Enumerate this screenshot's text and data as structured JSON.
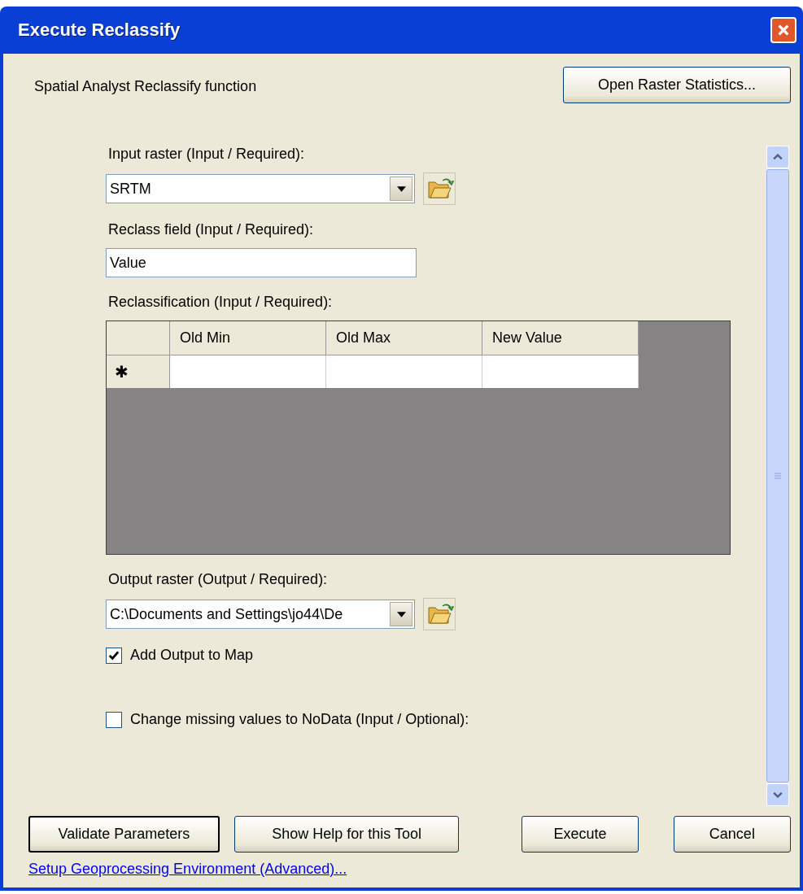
{
  "window": {
    "title": "Execute Reclassify"
  },
  "description": "Spatial Analyst Reclassify function",
  "stats_button": "Open Raster Statistics...",
  "parameters": [
    {
      "kind": "combo",
      "label": "Input raster (Input / Required):",
      "value": "SRTM"
    },
    {
      "kind": "text",
      "label": "Reclass field (Input / Required):",
      "value": "Value"
    },
    {
      "kind": "table",
      "label": "Reclassification (Input / Required):",
      "columns": [
        "Old Min",
        "Old Max",
        "New Value"
      ],
      "new_row_marker": "✱"
    },
    {
      "kind": "combo",
      "label": "Output raster (Output / Required):",
      "value": "C:\\Documents and Settings\\jo44\\De"
    },
    {
      "kind": "checkbox",
      "label": "Add Output to Map",
      "checked": true
    },
    {
      "kind": "checkbox",
      "label": "Change missing values to NoData (Input / Optional):",
      "checked": false
    }
  ],
  "buttons": [
    {
      "label": "Validate Parameters",
      "focused": true
    },
    {
      "label": "Show Help for this Tool",
      "focused": false
    },
    {
      "label": "Execute",
      "focused": false
    },
    {
      "label": "Cancel",
      "focused": false
    }
  ],
  "link": "Setup Geoprocessing Environment (Advanced)..."
}
